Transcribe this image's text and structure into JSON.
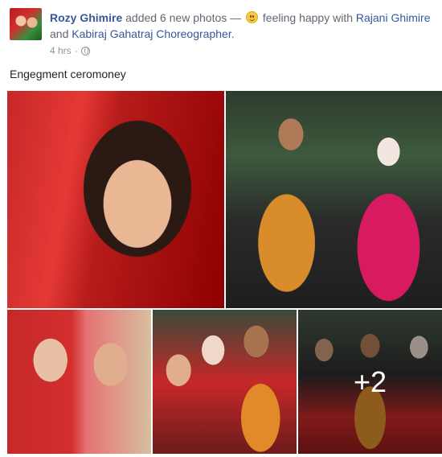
{
  "post": {
    "author": "Rozy Ghimire",
    "action_text": "added 6 new photos —",
    "feeling_text": "feeling happy with",
    "tagged": [
      "Rajani Ghimire",
      "Kabiraj Gahatraj Choreographer"
    ],
    "tag_joiner": "and",
    "tag_suffix": ".",
    "timestamp": "4 hrs",
    "meta_separator": "·",
    "privacy_icon": "globe-icon",
    "feeling_icon": "smiley-emoji-icon",
    "caption": "Engegment ceromoney"
  },
  "photos": {
    "more_label": "+2"
  },
  "colors": {
    "link": "#365899",
    "meta": "#90949c",
    "text": "#1d2129"
  }
}
